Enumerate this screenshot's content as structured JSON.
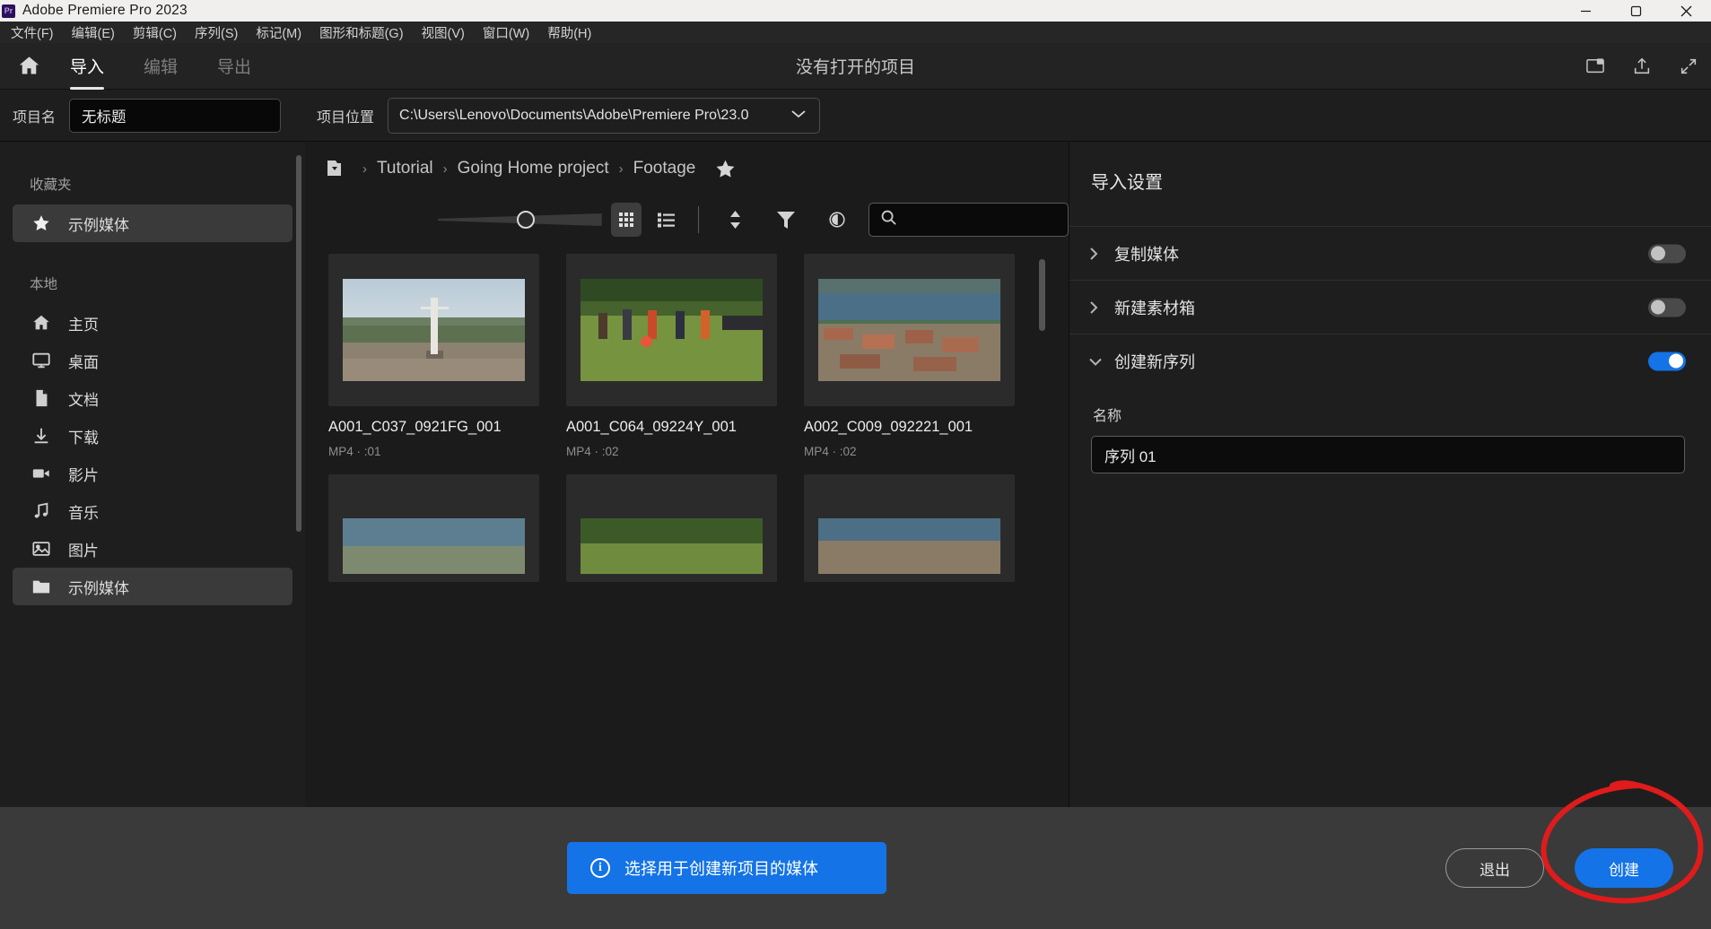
{
  "window": {
    "title": "Adobe Premiere Pro 2023",
    "logo_text": "Pr",
    "minimize": "minimize-icon",
    "maximize": "maximize-icon",
    "close": "close-icon"
  },
  "menubar": {
    "items": [
      {
        "label": "文件(F)"
      },
      {
        "label": "编辑(E)"
      },
      {
        "label": "剪辑(C)"
      },
      {
        "label": "序列(S)"
      },
      {
        "label": "标记(M)"
      },
      {
        "label": "图形和标题(G)"
      },
      {
        "label": "视图(V)"
      },
      {
        "label": "窗口(W)"
      },
      {
        "label": "帮助(H)"
      }
    ]
  },
  "workspace": {
    "home_icon": "home-icon",
    "tabs": [
      {
        "label": "导入",
        "active": true
      },
      {
        "label": "编辑",
        "active": false
      },
      {
        "label": "导出",
        "active": false
      }
    ],
    "title": "没有打开的项目",
    "right_icons": [
      "screen-icon",
      "share-icon",
      "fullscreen-icon"
    ]
  },
  "project": {
    "name_label": "项目名",
    "name_value": "无标题",
    "name_placeholder": "无标题",
    "location_label": "项目位置",
    "location_value": "C:\\Users\\Lenovo\\Documents\\Adobe\\Premiere Pro\\23.0",
    "location_caret": "chevron-down-icon"
  },
  "sidebar": {
    "groups": [
      {
        "title": "收藏夹",
        "items": [
          {
            "label": "示例媒体",
            "icon": "star-icon",
            "selected": true
          }
        ]
      },
      {
        "title": "本地",
        "items": [
          {
            "label": "主页",
            "icon": "home-icon",
            "selected": false
          },
          {
            "label": "桌面",
            "icon": "monitor-icon",
            "selected": false
          },
          {
            "label": "文档",
            "icon": "document-icon",
            "selected": false
          },
          {
            "label": "下载",
            "icon": "download-icon",
            "selected": false
          },
          {
            "label": "影片",
            "icon": "video-camera-icon",
            "selected": false
          },
          {
            "label": "音乐",
            "icon": "music-note-icon",
            "selected": false
          },
          {
            "label": "图片",
            "icon": "image-icon",
            "selected": false
          },
          {
            "label": "示例媒体",
            "icon": "folder-icon",
            "selected": true
          }
        ]
      }
    ]
  },
  "browser": {
    "breadcrumb": {
      "folder_icon": "folder-dropdown-icon",
      "items": [
        "Tutorial",
        "Going Home project",
        "Footage"
      ],
      "separator": "›",
      "star_icon": "star-icon"
    },
    "toolbar": {
      "zoom_slider_value": 42,
      "grid_view_icon": "grid-view-icon",
      "list_view_icon": "list-view-icon",
      "sort_icon": "sort-icon",
      "filter_icon": "filter-icon",
      "preview_icon": "eye-icon",
      "search_icon": "search-icon",
      "search_value": "",
      "search_placeholder": ""
    },
    "media": [
      {
        "title": "A001_C037_0921FG_001",
        "meta": "MP4 · :01",
        "scene": "monument"
      },
      {
        "title": "A001_C064_09224Y_001",
        "meta": "MP4 · :02",
        "scene": "soccer"
      },
      {
        "title": "A002_C009_092221_001",
        "meta": "MP4 · :02",
        "scene": "lake"
      },
      {
        "title": "",
        "meta": "",
        "scene": "lake2"
      },
      {
        "title": "",
        "meta": "",
        "scene": "field2"
      },
      {
        "title": "",
        "meta": "",
        "scene": "town2"
      }
    ]
  },
  "settings": {
    "title": "导入设置",
    "rows": [
      {
        "label": "复制媒体",
        "chevron": "chevron-right-icon",
        "toggle": "off",
        "expanded": false
      },
      {
        "label": "新建素材箱",
        "chevron": "chevron-right-icon",
        "toggle": "off",
        "expanded": false
      },
      {
        "label": "创建新序列",
        "chevron": "chevron-down-icon",
        "toggle": "on",
        "expanded": true
      }
    ],
    "sequence": {
      "name_label": "名称",
      "name_value": "序列 01",
      "name_placeholder": "序列 01"
    }
  },
  "bottom": {
    "info_icon": "info-icon",
    "info_text": "选择用于创建新项目的媒体",
    "exit_label": "退出",
    "create_label": "创建"
  },
  "colors": {
    "accent_blue": "#1473e6",
    "annotation_red": "#e01b1b",
    "panel_bg": "#1e1e1e",
    "bottom_bg": "#3a3a3a",
    "titlebar_bg": "#f0efed"
  },
  "annotation": {
    "shape": "hand-drawn-red-ellipse",
    "target": "create-button"
  }
}
